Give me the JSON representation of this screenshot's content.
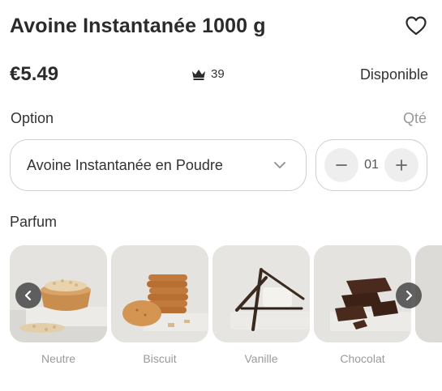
{
  "product": {
    "title": "Avoine Instantanée 1000 g",
    "price": "€5.49",
    "points": "39",
    "availability": "Disponible"
  },
  "option": {
    "label": "Option",
    "selected": "Avoine Instantanée en Poudre",
    "qty_label": "Qté",
    "qty_value": "01"
  },
  "flavor": {
    "label": "Parfum",
    "items": [
      {
        "name": "Neutre"
      },
      {
        "name": "Biscuit"
      },
      {
        "name": "Vanille"
      },
      {
        "name": "Chocolat"
      }
    ]
  },
  "icons": {
    "favorite": "heart-outline-icon",
    "points": "crown-icon",
    "dropdown": "chevron-down-icon",
    "decrease": "minus-icon",
    "increase": "plus-icon",
    "prev": "chevron-left-icon",
    "next": "chevron-right-icon"
  },
  "colors": {
    "text": "#2b2b2b",
    "muted": "#999999",
    "border": "#cfcfcf",
    "nav_button": "#464646"
  }
}
